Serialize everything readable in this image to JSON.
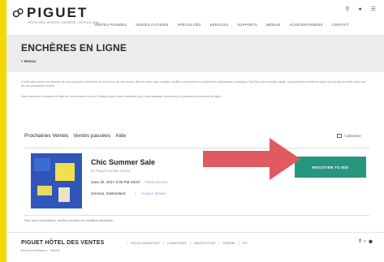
{
  "header": {
    "logo_text": "PIGUET",
    "logo_sub": "HÔTEL DES VENTES | GENÈVE | DEPUIS 1856",
    "nav": [
      "VENTES PASSÉES",
      "VENTES FUTURES",
      "SPÉCIALITÉS",
      "SERVICES",
      "SUPPORTS",
      "MÉDIAS",
      "ACHETER/VENDRE",
      "CONTACT"
    ]
  },
  "page": {
    "title": "ENCHÈRES EN LIGNE",
    "back_label": "< Retour",
    "intro_1": "L'hôtel des ventes est heureux de vous proposer d'enchérir en direct lors de nos ventes. Afin de créer votre compte, veuillez vous inscrire en suivant les instructions ci-dessous. Une fois votre compte validé, vous pourrez enchérir en ligne sur les lots de votre choix lors de nos prochaines ventes.",
    "intro_2": "Vous trouverez ci-dessous la liste de nos ventes en cours. N'hésitez pas à nous contacter pour toute question concernant le processus d'enchères en ligne."
  },
  "tabs": [
    "Prochaines Ventes",
    "Ventes passées",
    "Aide"
  ],
  "calendar_label": "Calendrier",
  "sale": {
    "title": "Chic Summer Sale",
    "subtitle": "by Piguet Auction House",
    "date": "June 20, 2017 3:00 PM CEST",
    "timed": "Timed auction",
    "location": "Geneva, Switzerland",
    "details": "Auction Details",
    "register_label": "REGISTER TO BID"
  },
  "footnote": "Pour plus d'informations, veuillez consulter nos conditions générales.",
  "footer": {
    "title": "PIGUET HÔTEL DES VENTES",
    "subtitle": "Rue de la Fontaine 4 · Genève",
    "links": [
      "NOUS CONTACTER",
      "CONDITIONS",
      "NEWSLETTER",
      "PRESSE",
      "FR"
    ]
  },
  "colors": {
    "background": "#f5d800",
    "accent": "#27967f",
    "arrow": "#e05a5f",
    "link": "#8aa4c8"
  }
}
